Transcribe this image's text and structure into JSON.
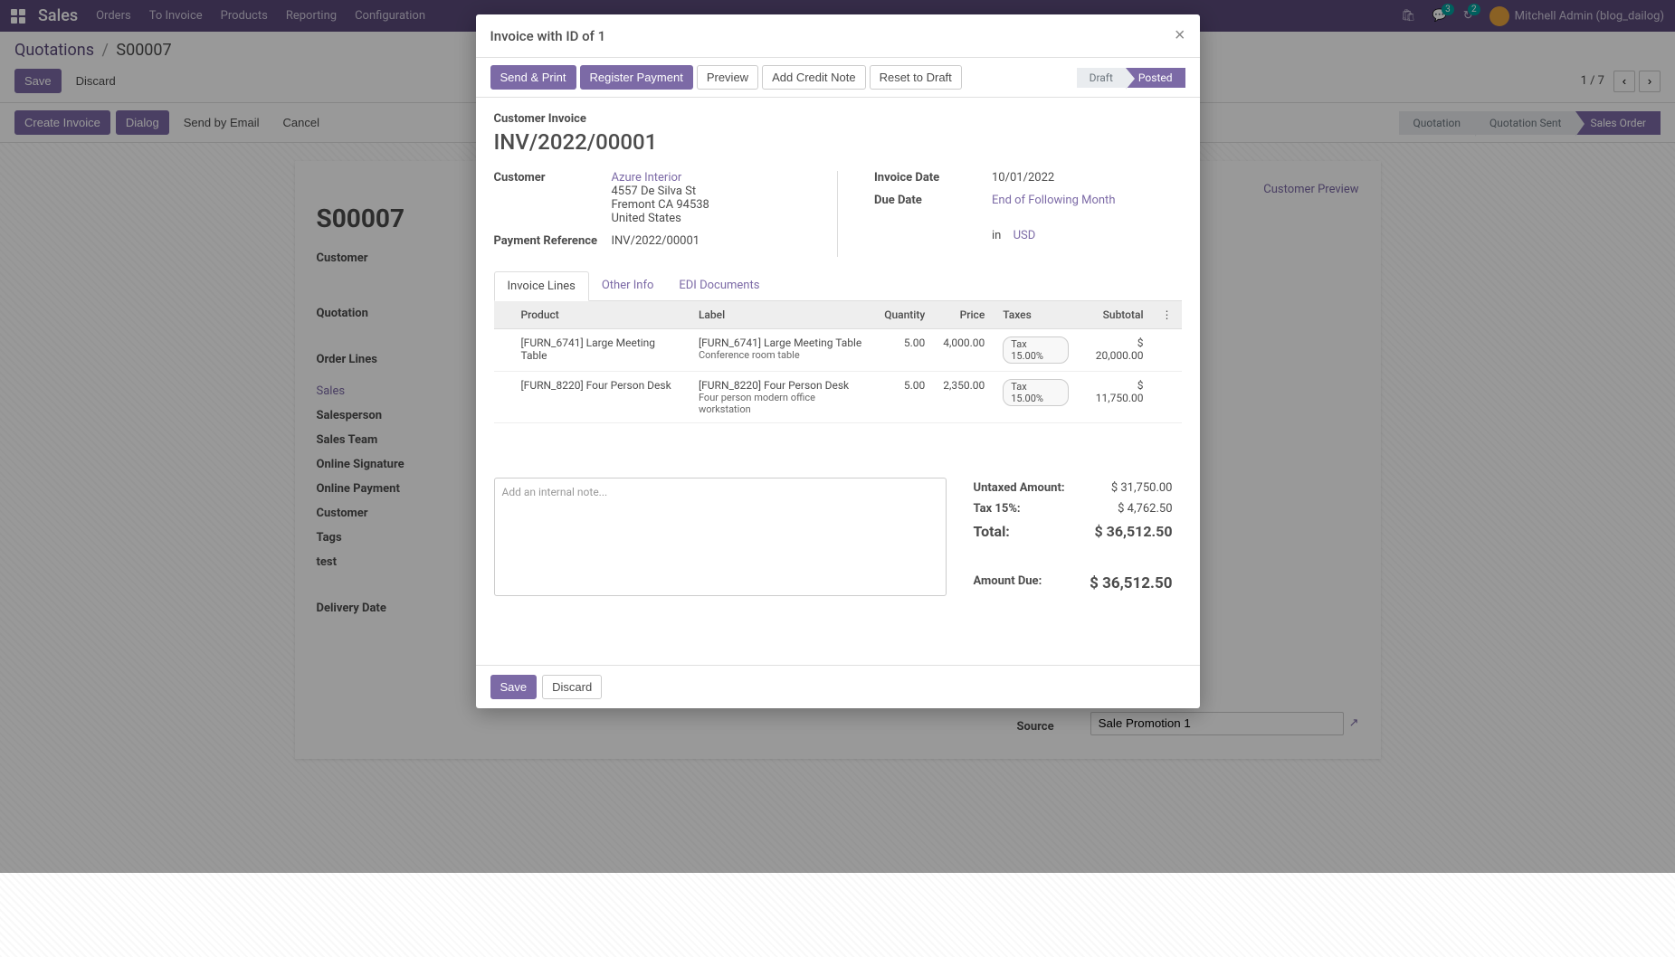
{
  "nav": {
    "brand": "Sales",
    "items": [
      "Orders",
      "To Invoice",
      "Products",
      "Reporting",
      "Configuration"
    ],
    "msg_badge": "3",
    "activity_badge": "2",
    "username": "Mitchell Admin (blog_dailog)"
  },
  "breadcrumb": {
    "parent": "Quotations",
    "current": "S00007"
  },
  "cp": {
    "save": "Save",
    "discard": "Discard",
    "pager": "1 / 7"
  },
  "actions": {
    "create_invoice": "Create Invoice",
    "dialog": "Dialog",
    "send_email": "Send by Email",
    "cancel": "Cancel",
    "preview": "Customer Preview"
  },
  "status": [
    "Quotation",
    "Quotation Sent",
    "Sales Order"
  ],
  "bg": {
    "order": "S00007",
    "labels": {
      "customer": "Customer",
      "quotation": "Quotation",
      "orderlines": "Order Lines",
      "sales": "Sales",
      "salesperson": "Salesperson",
      "salesteam": "Sales Team",
      "onlinesig": "Online Signature",
      "onlinepay": "Online Payment",
      "custref": "Customer",
      "tags": "Tags",
      "test": "test",
      "delivery": "Delivery Date",
      "source": "Source"
    },
    "source_value": "Sale Promotion 1"
  },
  "modal": {
    "title": "Invoice with ID of 1",
    "buttons": {
      "send_print": "Send & Print",
      "register_payment": "Register Payment",
      "preview": "Preview",
      "credit_note": "Add Credit Note",
      "reset_draft": "Reset to Draft"
    },
    "status": {
      "draft": "Draft",
      "posted": "Posted"
    },
    "type_label": "Customer Invoice",
    "inv_number": "INV/2022/00001",
    "left": {
      "customer_label": "Customer",
      "customer_name": "Azure Interior",
      "addr1": "4557 De Silva St",
      "addr2": "Fremont CA 94538",
      "addr3": "United States",
      "payref_label": "Payment Reference",
      "payref": "INV/2022/00001"
    },
    "right": {
      "inv_date_label": "Invoice Date",
      "inv_date": "10/01/2022",
      "due_label": "Due Date",
      "due_term": "End of Following Month",
      "in": "in",
      "currency": "USD"
    },
    "tabs": {
      "lines": "Invoice Lines",
      "other": "Other Info",
      "edi": "EDI Documents"
    },
    "table": {
      "headers": {
        "product": "Product",
        "label": "Label",
        "qty": "Quantity",
        "price": "Price",
        "taxes": "Taxes",
        "subtotal": "Subtotal"
      },
      "rows": [
        {
          "product": "[FURN_6741] Large Meeting Table",
          "label": "[FURN_6741] Large Meeting Table",
          "sublabel": "Conference room table",
          "qty": "5.00",
          "price": "4,000.00",
          "tax": "Tax 15.00%",
          "subtotal": "$ 20,000.00"
        },
        {
          "product": "[FURN_8220] Four Person Desk",
          "label": "[FURN_8220] Four Person Desk",
          "sublabel": "Four person modern office workstation",
          "qty": "5.00",
          "price": "2,350.00",
          "tax": "Tax 15.00%",
          "subtotal": "$ 11,750.00"
        }
      ]
    },
    "note_placeholder": "Add an internal note...",
    "totals": {
      "untaxed_label": "Untaxed Amount:",
      "untaxed": "$ 31,750.00",
      "tax_label": "Tax 15%:",
      "tax": "$ 4,762.50",
      "total_label": "Total:",
      "total": "$ 36,512.50",
      "due_label": "Amount Due:",
      "due": "$ 36,512.50"
    },
    "footer": {
      "save": "Save",
      "discard": "Discard"
    }
  }
}
